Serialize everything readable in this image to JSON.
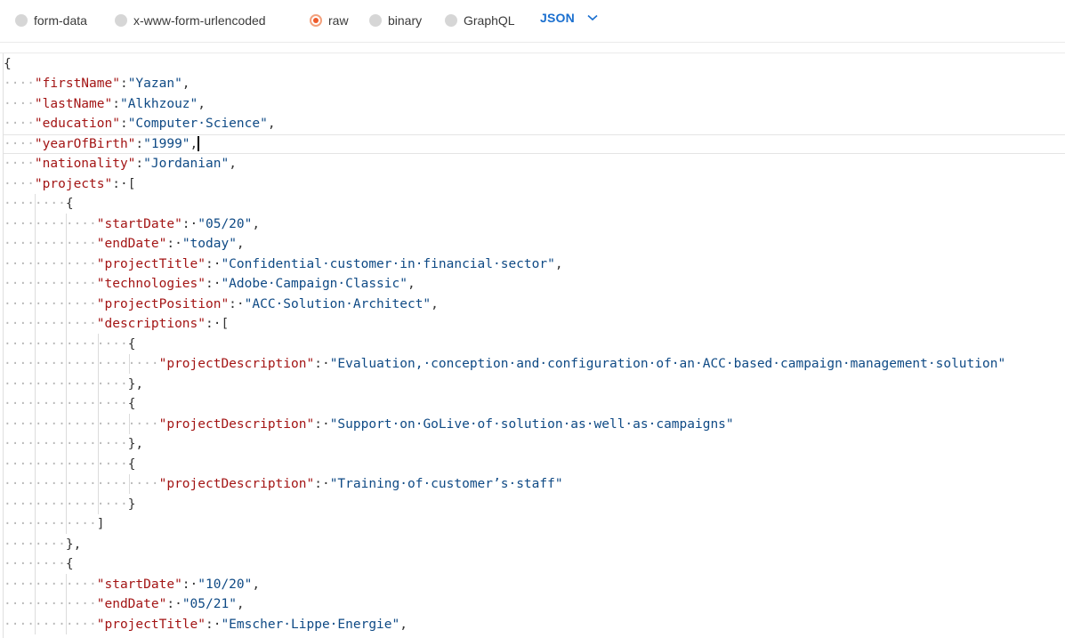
{
  "body_types": [
    {
      "label": "form-data",
      "selected": false
    },
    {
      "label": "x-www-form-urlencoded",
      "selected": false
    },
    {
      "label": "raw",
      "selected": true
    },
    {
      "label": "binary",
      "selected": false
    },
    {
      "label": "GraphQL",
      "selected": false
    }
  ],
  "language": {
    "label": "JSON"
  },
  "editor": {
    "lines": [
      {
        "indent": 0,
        "text": "{"
      },
      {
        "indent": 1,
        "text": "\"firstName\":\"Yazan\","
      },
      {
        "indent": 1,
        "text": "\"lastName\":\"Alkhzouz\","
      },
      {
        "indent": 1,
        "text": "\"education\":\"Computer Science\","
      },
      {
        "indent": 1,
        "text": "\"yearOfBirth\":\"1999\","
      },
      {
        "indent": 1,
        "text": "\"nationality\":\"Jordanian\","
      },
      {
        "indent": 1,
        "text": "\"projects\": ["
      },
      {
        "indent": 2,
        "text": "{"
      },
      {
        "indent": 3,
        "text": "\"startDate\": \"05/20\","
      },
      {
        "indent": 3,
        "text": "\"endDate\": \"today\","
      },
      {
        "indent": 3,
        "text": "\"projectTitle\": \"Confidential customer in financial sector\","
      },
      {
        "indent": 3,
        "text": "\"technologies\": \"Adobe Campaign Classic\","
      },
      {
        "indent": 3,
        "text": "\"projectPosition\": \"ACC Solution Architect\","
      },
      {
        "indent": 3,
        "text": "\"descriptions\": ["
      },
      {
        "indent": 4,
        "text": "{"
      },
      {
        "indent": 5,
        "text": "\"projectDescription\": \"Evaluation, conception and configuration of an ACC based campaign management solution\""
      },
      {
        "indent": 4,
        "text": "},"
      },
      {
        "indent": 4,
        "text": "{"
      },
      {
        "indent": 5,
        "text": "\"projectDescription\": \"Support on GoLive of solution as well as campaigns\""
      },
      {
        "indent": 4,
        "text": "},"
      },
      {
        "indent": 4,
        "text": "{"
      },
      {
        "indent": 5,
        "text": "\"projectDescription\": \"Training of customer’s staff\""
      },
      {
        "indent": 4,
        "text": "}"
      },
      {
        "indent": 3,
        "text": "]"
      },
      {
        "indent": 2,
        "text": "},"
      },
      {
        "indent": 2,
        "text": "{"
      },
      {
        "indent": 3,
        "text": "\"startDate\": \"10/20\","
      },
      {
        "indent": 3,
        "text": "\"endDate\": \"05/21\","
      },
      {
        "indent": 3,
        "text": "\"projectTitle\": \"Emscher Lippe Energie\","
      }
    ],
    "active_line": 4
  },
  "colors": {
    "key": "#a31515",
    "string": "#0f4a85",
    "radio_selected": "#ee5b2b",
    "language_accent": "#1a6fcf"
  }
}
